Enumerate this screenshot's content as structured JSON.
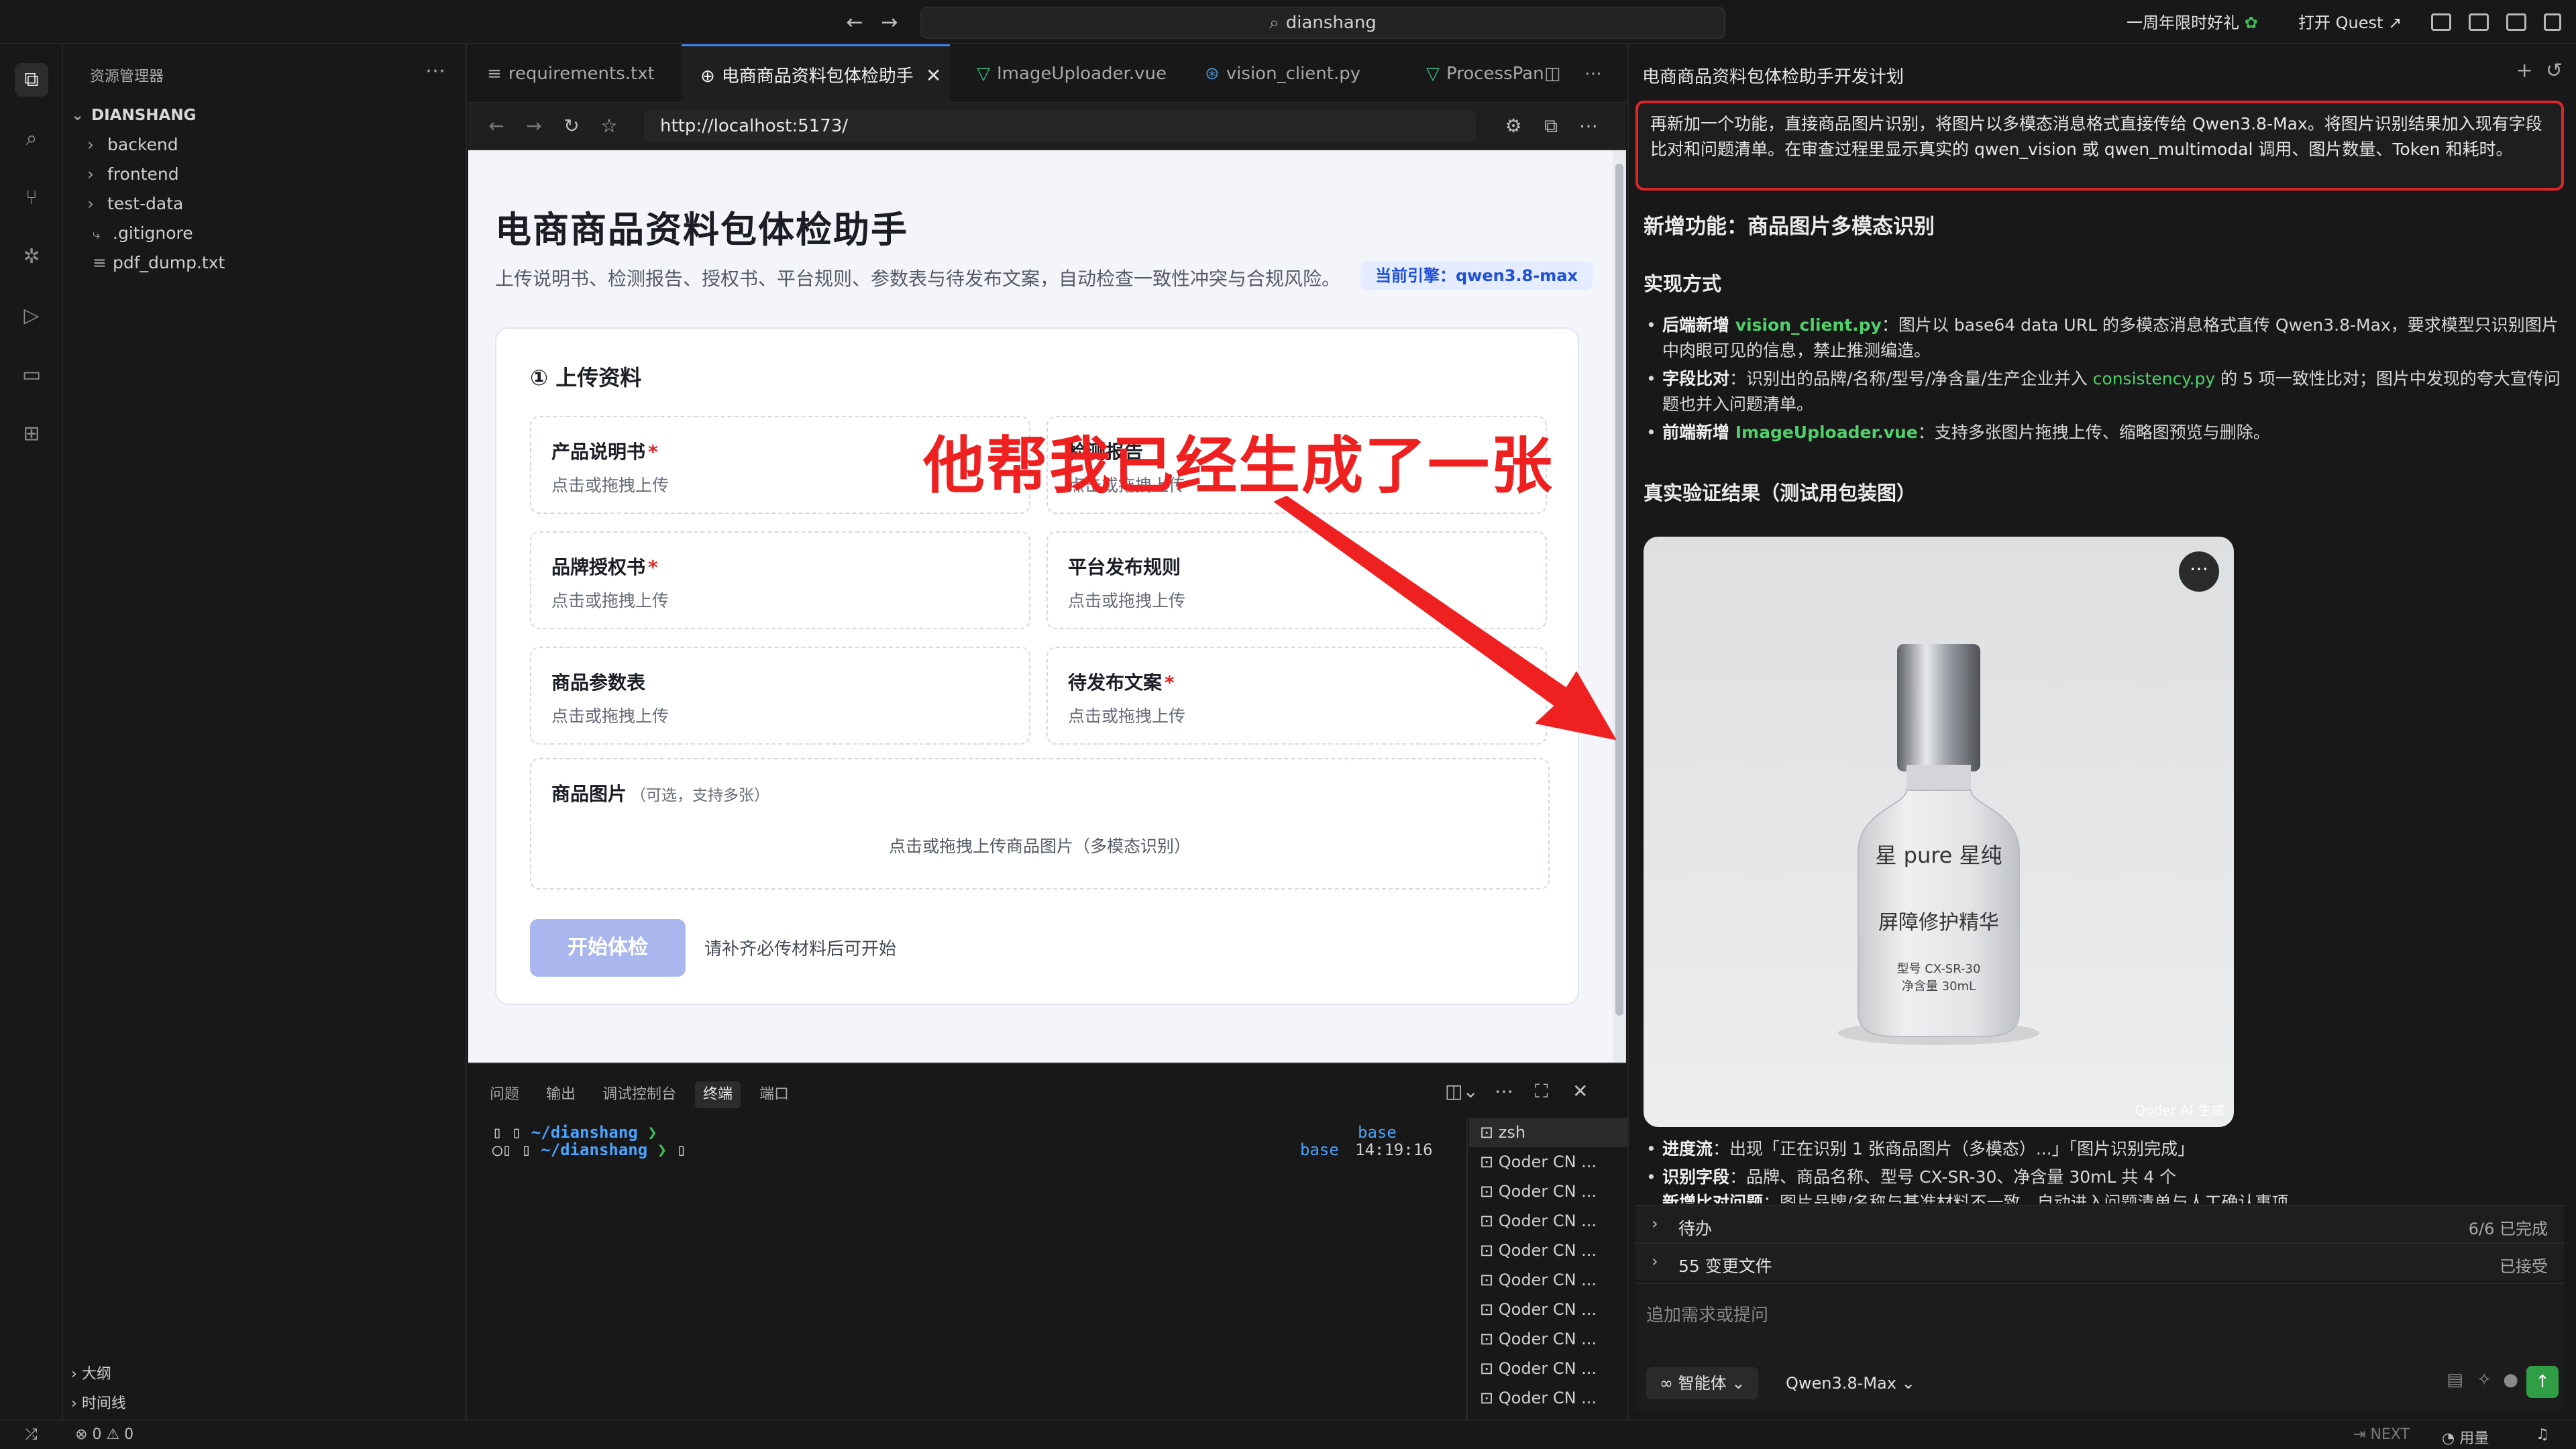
{
  "titlebar": {
    "search_text": "dianshang",
    "promo_label": "一周年限时好礼",
    "quest_label": "打开 Quest"
  },
  "explorer": {
    "title": "资源管理器",
    "root": "DIANSHANG",
    "items": [
      {
        "label": "backend",
        "type": "folder"
      },
      {
        "label": "frontend",
        "type": "folder"
      },
      {
        "label": "test-data",
        "type": "folder"
      },
      {
        "label": ".gitignore",
        "type": "file"
      },
      {
        "label": "pdf_dump.txt",
        "type": "file"
      }
    ],
    "outline_label": "大纲",
    "timeline_label": "时间线"
  },
  "tabs": [
    {
      "label": "requirements.txt",
      "icon": "list-icon",
      "active": false
    },
    {
      "label": "电商商品资料包体检助手",
      "icon": "globe-icon",
      "active": true
    },
    {
      "label": "ImageUploader.vue",
      "icon": "vue-icon",
      "active": false
    },
    {
      "label": "vision_client.py",
      "icon": "python-icon",
      "active": false
    },
    {
      "label": "ProcessPan",
      "icon": "vue-icon",
      "active": false
    }
  ],
  "browser": {
    "url": "http://localhost:5173/"
  },
  "app": {
    "title": "电商商品资料包体检助手",
    "description": "上传说明书、检测报告、授权书、平台规则、参数表与待发布文案，自动检查一致性冲突与合规风险。",
    "engine_badge": "当前引擎：qwen3.8-max",
    "upload_section_title": "① 上传资料",
    "uploads": [
      {
        "label": "产品说明书",
        "required": "*",
        "hint": "点击或拖拽上传"
      },
      {
        "label": "检测报告",
        "required": "",
        "hint": "点击或拖拽上传"
      },
      {
        "label": "品牌授权书",
        "required": "*",
        "hint": "点击或拖拽上传"
      },
      {
        "label": "平台发布规则",
        "required": "",
        "hint": "点击或拖拽上传"
      },
      {
        "label": "商品参数表",
        "required": "",
        "hint": "点击或拖拽上传"
      },
      {
        "label": "待发布文案",
        "required": "*",
        "hint": "点击或拖拽上传"
      }
    ],
    "image_upload": {
      "label": "商品图片",
      "sub": "（可选，支持多张）",
      "hint": "点击或拖拽上传商品图片（多模态识别）"
    },
    "start_button": "开始体检",
    "start_hint": "请补齐必传材料后可开始"
  },
  "annotation": {
    "text": "他帮我已经生成了一张",
    "color": "#ef2020"
  },
  "panel": {
    "tabs": [
      "问题",
      "输出",
      "调试控制台",
      "终端",
      "端口"
    ],
    "active_tab": "终端",
    "cwd": "~/dianshang",
    "prompt_char": "❯",
    "env": "base",
    "time": "14:19:16",
    "terminals": [
      "zsh",
      "Qoder CN ...",
      "Qoder CN ...",
      "Qoder CN ...",
      "Qoder CN ...",
      "Qoder CN ...",
      "Qoder CN ...",
      "Qoder CN ...",
      "Qoder CN ...",
      "Qoder CN ..."
    ]
  },
  "chat": {
    "title": "电商商品资料包体检助手开发计划",
    "user_message": "再新加一个功能，直接商品图片识别，将图片以多模态消息格式直接传给 Qwen3.8-Max。将图片识别结果加入现有字段比对和问题清单。在审查过程里显示真实的 qwen_vision 或 qwen_multimodal 调用、图片数量、Token 和耗时。",
    "heading": "新增功能：商品图片多模态识别",
    "impl_heading": "实现方式",
    "bullets": [
      {
        "bold": "后端新增 ",
        "code": "vision_client.py",
        "text": "：图片以 base64 data URL 的多模态消息格式直传 Qwen3.8-Max，要求模型只识别图片中肉眼可见的信息，禁止推测编造。"
      },
      {
        "bold": "字段比对",
        "code": "",
        "text_pre": "：识别出的品牌/名称/型号/净含量/生产企业并入 ",
        "code2": "consistency.py",
        "text": " 的 5 项一致性比对；图片中发现的夸大宣传问题也并入问题清单。"
      },
      {
        "bold": "前端新增 ",
        "code": "ImageUploader.vue",
        "text": "：支持多张图片拖拽上传、缩略图预览与删除。"
      }
    ],
    "verify_heading": "真实验证结果（测试用包装图）",
    "product_image": {
      "brand": "星 pure 星纯",
      "name": "屏障修护精华",
      "model": "型号 CX-SR-30",
      "volume": "净含量 30mL",
      "watermark": "Qoder AI 生成"
    },
    "results": [
      {
        "bold": "进度流",
        "text": "：出现「正在识别 1 张商品图片（多模态）...」「图片识别完成」"
      },
      {
        "bold": "识别字段",
        "text": "：品牌、商品名称、型号 CX-SR-30、净含量 30mL 共 4 个"
      },
      {
        "bold": "新增比对问题",
        "text": "：图片品牌/名称与基准材料不一致，自动进入问题清单与人工确认事项"
      }
    ],
    "todo_label": "待办",
    "todo_status": "6/6 已完成",
    "changes_label": "55 变更文件",
    "changes_status": "已接受",
    "input_placeholder": "追加需求或提问",
    "mode_label": "智能体",
    "model_label": "Qwen3.8-Max"
  },
  "statusbar": {
    "errors": "0",
    "warnings": "0",
    "next_label": "NEXT",
    "usage_label": "用量"
  }
}
